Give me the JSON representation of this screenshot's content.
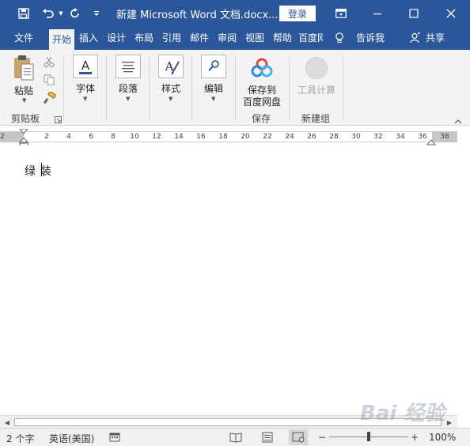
{
  "window": {
    "title": "新建 Microsoft Word 文档.docx...",
    "login_label": "登录",
    "accent_color": "#2b579a"
  },
  "quick_access": {
    "save_icon": "save-icon",
    "undo_icon": "undo-icon",
    "redo_icon": "redo-icon",
    "customize_icon": "customize-qat-icon"
  },
  "tabs": [
    "文件",
    "开始",
    "插入",
    "设计",
    "布局",
    "引用",
    "邮件",
    "审阅",
    "视图",
    "帮助",
    "百度网"
  ],
  "active_tab": "开始",
  "tell_me": "告诉我",
  "share": "共享",
  "ribbon": {
    "paste_label": "粘贴",
    "clipboard_group": "剪贴板",
    "font_label": "字体",
    "paragraph_label": "段落",
    "styles_label": "样式",
    "editing_label": "编辑",
    "save_to_baidu_line1": "保存到",
    "save_to_baidu_line2": "百度网盘",
    "save_group": "保存",
    "tool_calc_label": "工具计算",
    "new_group": "新建组"
  },
  "ruler": {
    "numbers": [
      "2",
      "2",
      "4",
      "6",
      "8",
      "10",
      "12",
      "14",
      "16",
      "18",
      "20",
      "22",
      "24",
      "26",
      "28",
      "30",
      "32",
      "34",
      "36",
      "38"
    ]
  },
  "document": {
    "text": "绿装"
  },
  "statusbar": {
    "word_count": "2 个字",
    "language": "英语(美国)",
    "zoom": "100%",
    "zoom_minus": "−",
    "zoom_plus": "+",
    "zoom_level": 1.0
  },
  "watermark": "Bai 经验"
}
